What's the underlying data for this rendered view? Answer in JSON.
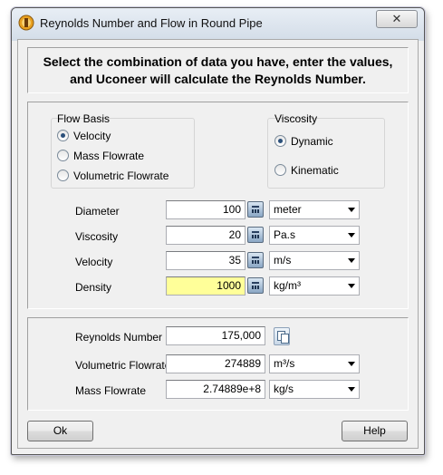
{
  "window": {
    "title": "Reynolds Number and Flow in Round Pipe",
    "close_glyph": "✕"
  },
  "instructions": {
    "line1": "Select the combination of data you have, enter the values,",
    "line2": "and Uconeer will calculate the Reynolds Number."
  },
  "flow_basis": {
    "label": "Flow Basis",
    "options": [
      {
        "label": "Velocity",
        "selected": true
      },
      {
        "label": "Mass Flowrate",
        "selected": false
      },
      {
        "label": "Volumetric Flowrate",
        "selected": false
      }
    ]
  },
  "viscosity_type": {
    "label": "Viscosity",
    "options": [
      {
        "label": "Dynamic",
        "selected": true
      },
      {
        "label": "Kinematic",
        "selected": false
      }
    ]
  },
  "inputs": [
    {
      "label": "Diameter",
      "value": "100",
      "unit": "meter",
      "highlighted": false
    },
    {
      "label": "Viscosity",
      "value": "20",
      "unit": "Pa.s",
      "highlighted": false
    },
    {
      "label": "Velocity",
      "value": "35",
      "unit": "m/s",
      "highlighted": false
    },
    {
      "label": "Density",
      "value": "1000",
      "unit": "kg/m³",
      "highlighted": true
    }
  ],
  "results": {
    "reynolds": {
      "label": "Reynolds Number",
      "value": "175,000"
    },
    "volumetric": {
      "label": "Volumetric Flowrate",
      "value": "274889",
      "unit": "m³/s"
    },
    "mass": {
      "label": "Mass Flowrate",
      "value": "2.74889e+8",
      "unit": "kg/s"
    }
  },
  "buttons": {
    "ok": "Ok",
    "help": "Help"
  },
  "icons": {
    "app": "uconeer-app-icon",
    "calc": "calculator-icon",
    "copy": "copy-icon",
    "close": "close-icon",
    "dropdown": "chevron-down-icon"
  },
  "colors": {
    "highlight_input": "#ffff99",
    "title_bar": "#dbe4ee",
    "window_bg": "#f0f0f0"
  }
}
